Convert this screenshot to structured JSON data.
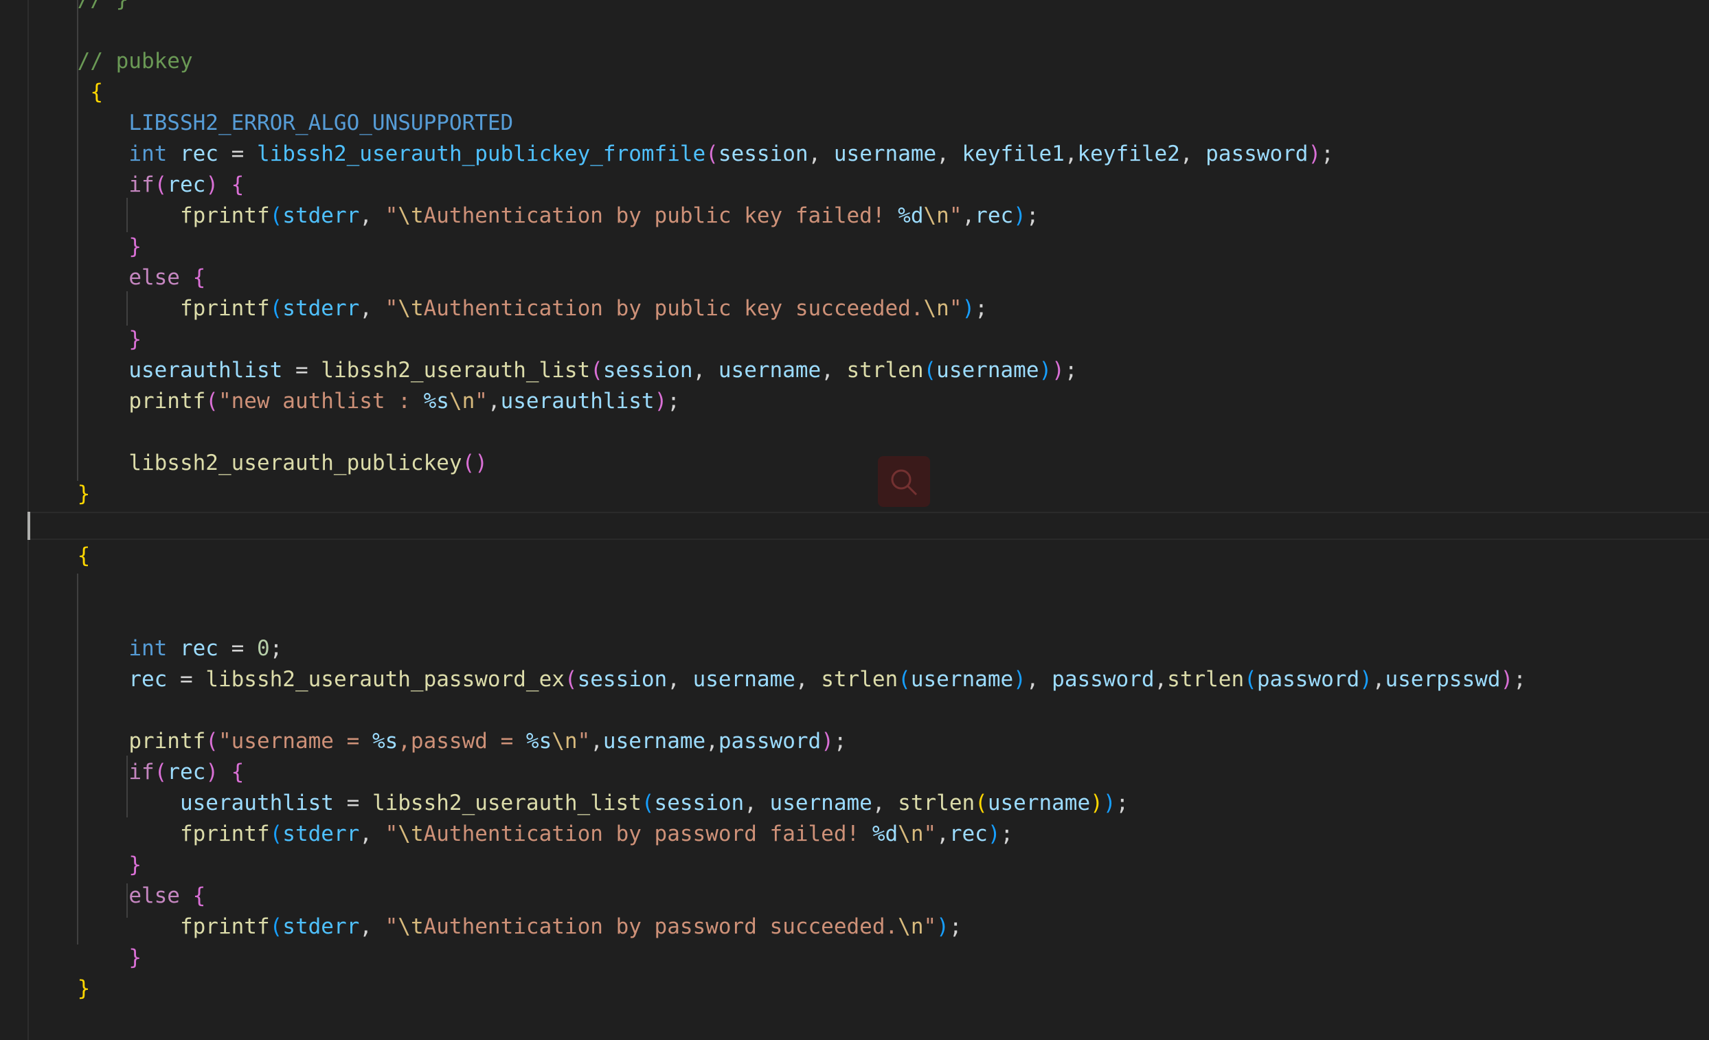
{
  "editor": {
    "language": "c",
    "colors": {
      "background": "#1f1f1f",
      "comment": "#6a9955",
      "keyword": "#569cd6",
      "control": "#c586c0",
      "function": "#dcdcaa",
      "variable": "#9cdcfe",
      "string": "#ce9178",
      "bracket_gold": "#ffd700",
      "bracket_purple": "#da70d6",
      "bracket_blue": "#179fff"
    },
    "lines": [
      "    // }",
      "",
      "    // pubkey",
      "     {",
      "        LIBSSH2_ERROR_ALGO_UNSUPPORTED",
      "        int rec = libssh2_userauth_publickey_fromfile(session, username, keyfile1,keyfile2, password);",
      "        if(rec) {",
      "            fprintf(stderr, \"\\tAuthentication by public key failed! %d\\n\",rec);",
      "        }",
      "        else {",
      "            fprintf(stderr, \"\\tAuthentication by public key succeeded.\\n\");",
      "        }",
      "        userauthlist = libssh2_userauth_list(session, username, strlen(username));",
      "        printf(\"new authlist : %s\\n\",userauthlist);",
      "",
      "        libssh2_userauth_publickey()",
      "    }",
      "",
      "    {",
      "",
      "",
      "        int rec = 0;",
      "        rec = libssh2_userauth_password_ex(session, username, strlen(username), password,strlen(password),userpsswd);",
      "",
      "        printf(\"username = %s,passwd = %s\\n\",username,password);",
      "        if(rec) {",
      "            userauthlist = libssh2_userauth_list(session, username, strlen(username));",
      "            fprintf(stderr, \"\\tAuthentication by password failed! %d\\n\",rec);",
      "        }",
      "        else {",
      "            fprintf(stderr, \"\\tAuthentication by password succeeded.\\n\");",
      "        }",
      "    }"
    ],
    "overlay_icon": "search-icon"
  }
}
